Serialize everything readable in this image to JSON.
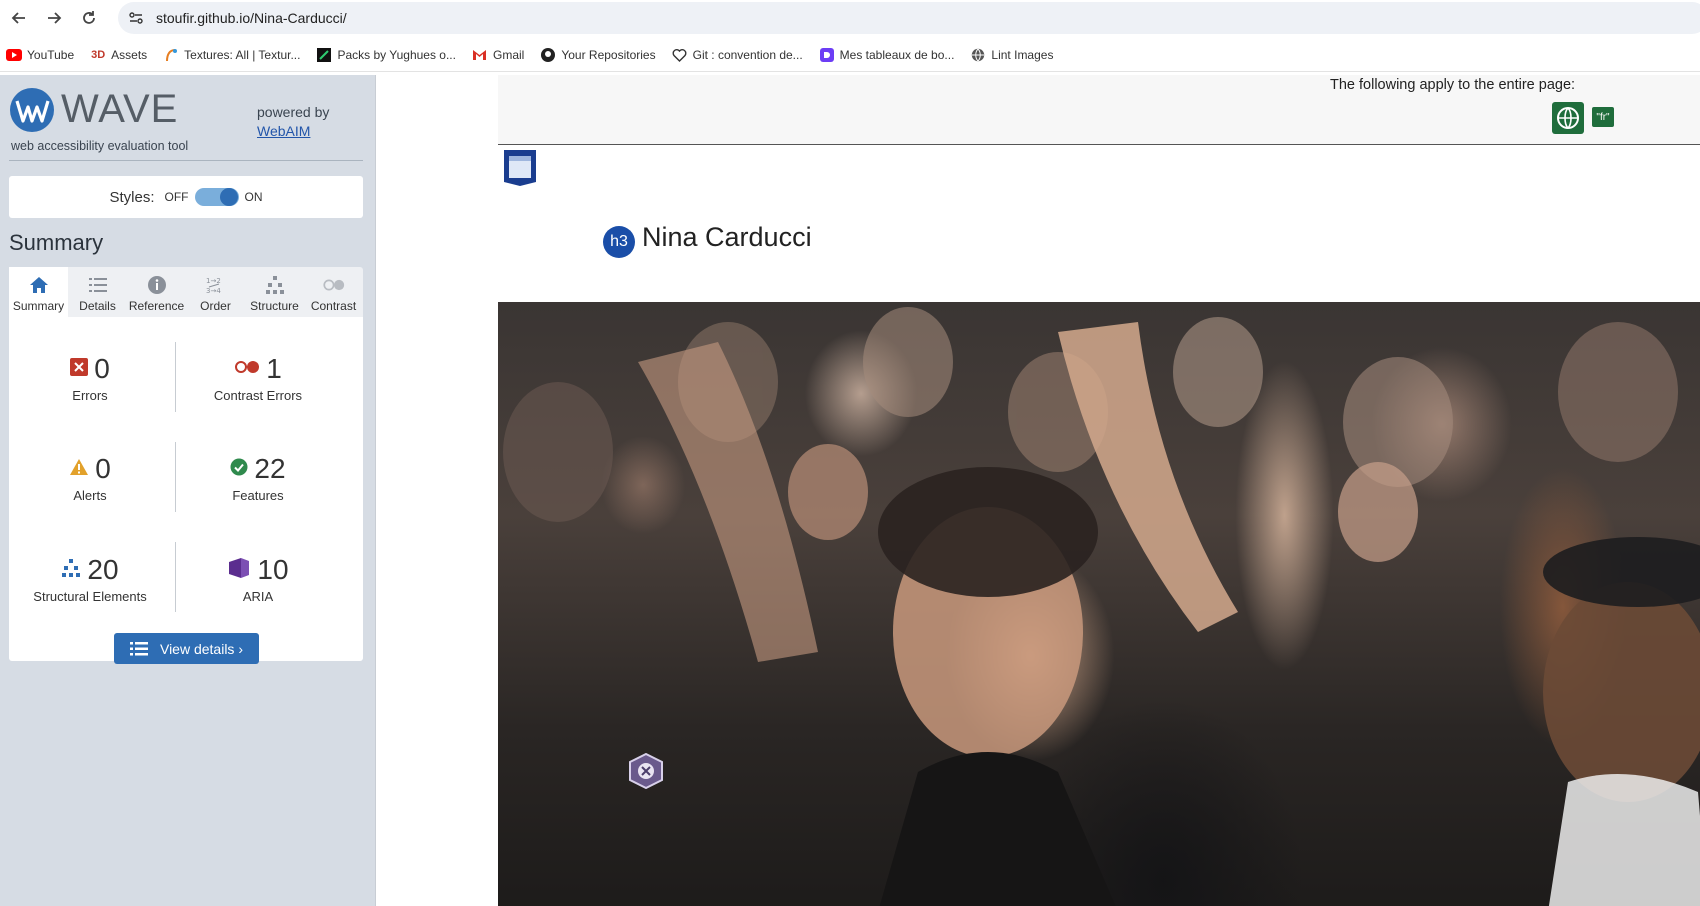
{
  "browser": {
    "url": "stoufir.github.io/Nina-Carducci/",
    "bookmarks": [
      {
        "label": "YouTube",
        "icon": "youtube-icon",
        "color": "#ff0000"
      },
      {
        "label": "Assets",
        "icon": "3d-icon",
        "color": "#c0392b"
      },
      {
        "label": "Textures: All | Textur...",
        "icon": "textures-icon",
        "color": "#e67e22"
      },
      {
        "label": "Packs by Yughues o...",
        "icon": "packs-icon",
        "color": "#111111"
      },
      {
        "label": "Gmail",
        "icon": "gmail-icon",
        "color": "#d93025"
      },
      {
        "label": "Your Repositories",
        "icon": "github-icon",
        "color": "#222222"
      },
      {
        "label": "Git : convention de...",
        "icon": "heart-icon",
        "color": "#333333"
      },
      {
        "label": "Mes tableaux de bo...",
        "icon": "trello-like-icon",
        "color": "#6c3df5"
      },
      {
        "label": "Lint Images",
        "icon": "globe-icon",
        "color": "#555555"
      }
    ]
  },
  "wave": {
    "title": "WAVE",
    "subtitle": "web accessibility evaluation tool",
    "powered_by": "powered by",
    "webaim": "WebAIM",
    "styles_label": "Styles:",
    "styles_off": "OFF",
    "styles_on": "ON",
    "styles_enabled": true,
    "summary_heading": "Summary",
    "tabs": [
      {
        "label": "Summary",
        "icon": "home-icon"
      },
      {
        "label": "Details",
        "icon": "list-icon"
      },
      {
        "label": "Reference",
        "icon": "info-icon"
      },
      {
        "label": "Order",
        "icon": "order-icon"
      },
      {
        "label": "Structure",
        "icon": "structure-icon"
      },
      {
        "label": "Contrast",
        "icon": "contrast-icon"
      }
    ],
    "active_tab": "Summary",
    "stats": {
      "errors": {
        "value": "0",
        "label": "Errors",
        "color": "#c0392b"
      },
      "contrast": {
        "value": "1",
        "label": "Contrast Errors",
        "color": "#c0392b"
      },
      "alerts": {
        "value": "0",
        "label": "Alerts",
        "color": "#e2a12b"
      },
      "features": {
        "value": "22",
        "label": "Features",
        "color": "#2f8a4d"
      },
      "structural": {
        "value": "20",
        "label": "Structural Elements",
        "color": "#2e6db4"
      },
      "aria": {
        "value": "10",
        "label": "ARIA",
        "color": "#5b2d8f"
      }
    },
    "view_details": "View details ›"
  },
  "page": {
    "apply_text": "The following apply to the entire page:",
    "lang_badge": "\"fr\"",
    "h3_badge": "h3",
    "heading": "Nina Carducci",
    "colors": {
      "wave_green": "#1f6d3c",
      "wave_blue": "#1a4ea8"
    }
  }
}
